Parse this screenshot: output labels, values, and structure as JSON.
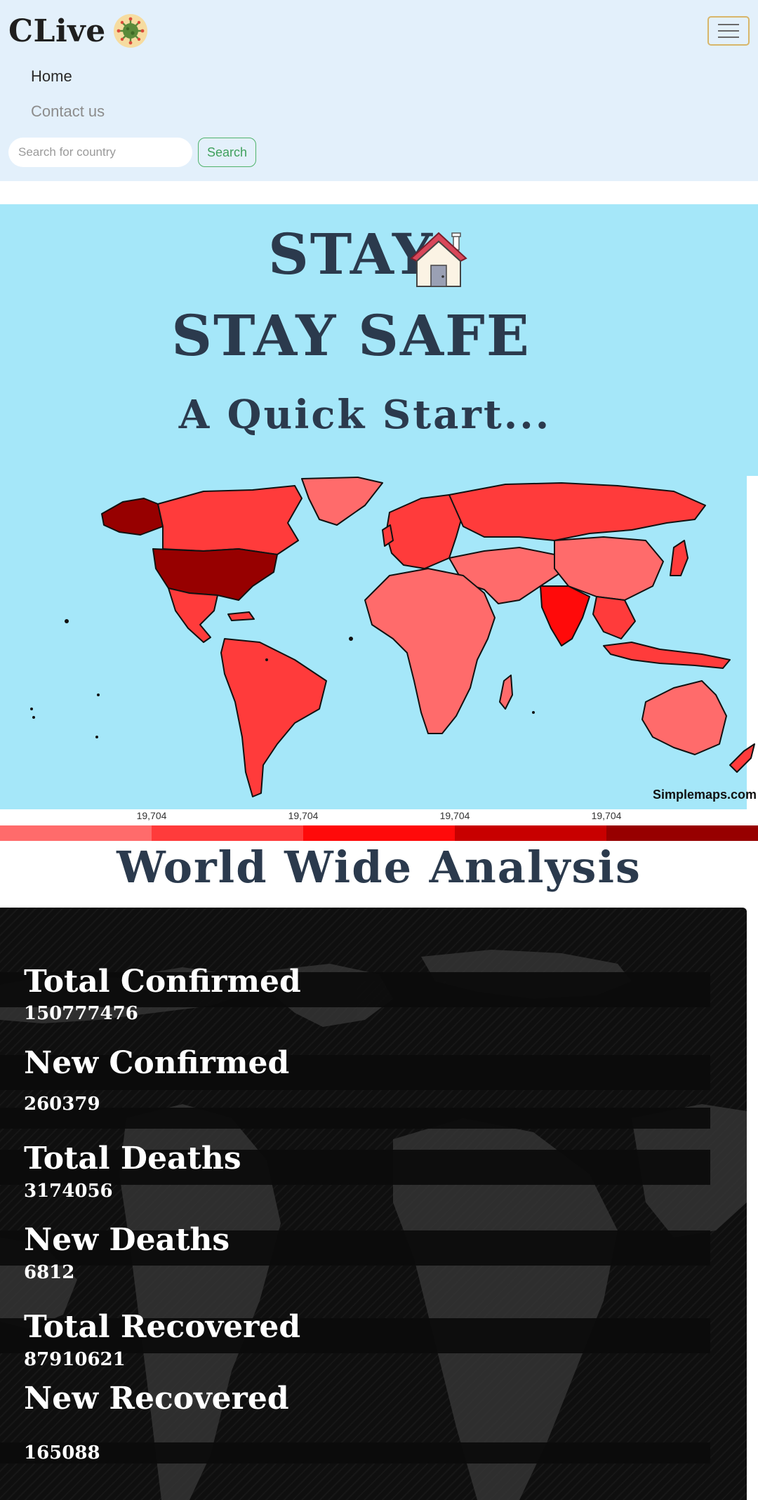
{
  "navbar": {
    "brand": "CLive",
    "links": {
      "home": "Home",
      "contact": "Contact us"
    },
    "search": {
      "placeholder": "Search for country",
      "value": "",
      "button": "Search"
    }
  },
  "hero": {
    "line1": "STAY",
    "line2": "STAY SAFE",
    "line3": "A Quick Start...",
    "map_credit": "Simplemaps.com"
  },
  "legend": {
    "labels": [
      "19,704",
      "19,704",
      "19,704",
      "19,704"
    ],
    "colors": [
      "#ff6b6b",
      "#ff3b3b",
      "#ff0a0a",
      "#c80000",
      "#970000"
    ]
  },
  "analysis": {
    "title": "World Wide Analysis",
    "stats": [
      {
        "label": "Total Confirmed",
        "value": "150777476"
      },
      {
        "label": "New Confirmed",
        "value": "260379"
      },
      {
        "label": "Total Deaths",
        "value": "3174056"
      },
      {
        "label": "New Deaths",
        "value": "6812"
      },
      {
        "label": "Total Recovered",
        "value": "87910621"
      },
      {
        "label": "New Recovered",
        "value": "165088"
      }
    ]
  }
}
